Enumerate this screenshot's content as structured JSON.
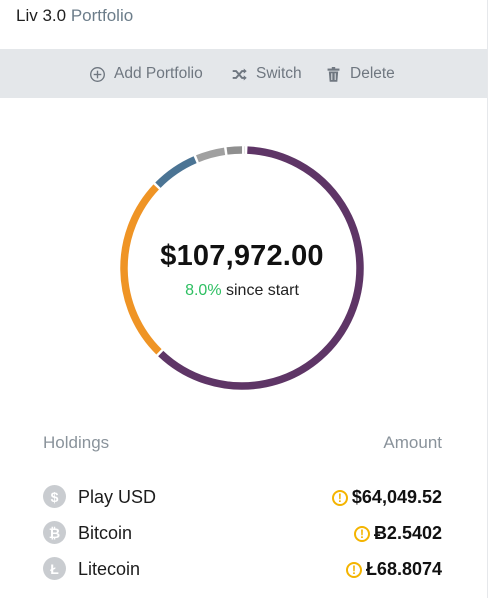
{
  "header": {
    "title": "Liv 3.0",
    "title_accent": "Portfolio"
  },
  "toolbar": {
    "add_label": "Add Portfolio",
    "switch_label": "Switch",
    "delete_label": "Delete"
  },
  "summary": {
    "total_value": "$107,972.00",
    "change_pct": "8.0%",
    "change_suffix": "since start"
  },
  "chart_data": {
    "type": "pie",
    "style": "donut",
    "values": [
      64049.52,
      25905,
      6700,
      4300,
      2450,
      400
    ],
    "colors": [
      "#5e3566",
      "#ef9425",
      "#4b7494",
      "#a0a0a0",
      "#8f8f8f",
      "#b5b5b5"
    ],
    "title": "",
    "xlabel": "",
    "ylabel": ""
  },
  "holdings": {
    "col_name": "Holdings",
    "col_amount": "Amount",
    "rows": [
      {
        "icon": "$",
        "icon_name": "dollar-coin-icon",
        "name": "Play USD",
        "amount": "$64,049.52"
      },
      {
        "icon": "₿",
        "icon_name": "bitcoin-icon",
        "name": "Bitcoin",
        "amount": "Ƀ2.5402"
      },
      {
        "icon": "Ł",
        "icon_name": "litecoin-icon",
        "name": "Litecoin",
        "amount": "Ł68.8074"
      }
    ]
  }
}
